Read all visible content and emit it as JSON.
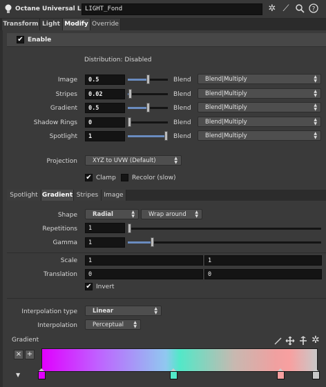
{
  "window": {
    "title": "Octane Universal Light",
    "node_name": "LIGHT_Fond"
  },
  "tabs": [
    "Transform",
    "Light",
    "Modify",
    "Override"
  ],
  "active_tab": "Modify",
  "enable": {
    "label": "Enable",
    "checked": true
  },
  "distribution": "Distribution: Disabled",
  "layers": [
    {
      "label": "Image",
      "value": "0.5",
      "blend_label": "Blend",
      "blend_mode": "Blend|Multiply",
      "fraction": 0.5
    },
    {
      "label": "Stripes",
      "value": "0.02",
      "blend_label": "Blend",
      "blend_mode": "Blend|Multiply",
      "fraction": 0.02
    },
    {
      "label": "Gradient",
      "value": "0.5",
      "blend_label": "Blend",
      "blend_mode": "Blend|Multiply",
      "fraction": 0.5
    },
    {
      "label": "Shadow Rings",
      "value": "0",
      "blend_label": "Blend",
      "blend_mode": "Blend|Multiply",
      "fraction": 0
    },
    {
      "label": "Spotlight",
      "value": "1",
      "blend_label": "Blend",
      "blend_mode": "Blend|Multiply",
      "fraction": 1
    }
  ],
  "projection": {
    "label": "Projection",
    "value": "XYZ to UVW  (Default)"
  },
  "clamp": {
    "label": "Clamp",
    "checked": true
  },
  "recolor": {
    "label": "Recolor (slow)",
    "checked": false
  },
  "sub_tabs": [
    "Spotlight",
    "Gradient",
    "Stripes",
    "Image"
  ],
  "active_sub_tab": "Gradient",
  "gradient": {
    "shape_label": "Shape",
    "shape_value": "Radial",
    "wrap_value": "Wrap around",
    "repetitions_label": "Repetitions",
    "repetitions_value": "1",
    "repetitions_fraction": 0.0,
    "gamma_label": "Gamma",
    "gamma_value": "1",
    "gamma_fraction": 0.12,
    "scale_label": "Scale",
    "scale_x": "1",
    "scale_y": "1",
    "translation_label": "Translation",
    "translation_x": "0",
    "translation_y": "0",
    "invert": {
      "label": "Invert",
      "checked": true
    },
    "interp_type_label": "Interpolation type",
    "interp_type_value": "Linear",
    "interp_label": "Interpolation",
    "interp_value": "Perceptual",
    "ramp_label": "Gradient",
    "ramp_colors": [
      "#e000ff",
      "#52e8c8",
      "#f8a0a0",
      "#c8c8c8"
    ]
  }
}
